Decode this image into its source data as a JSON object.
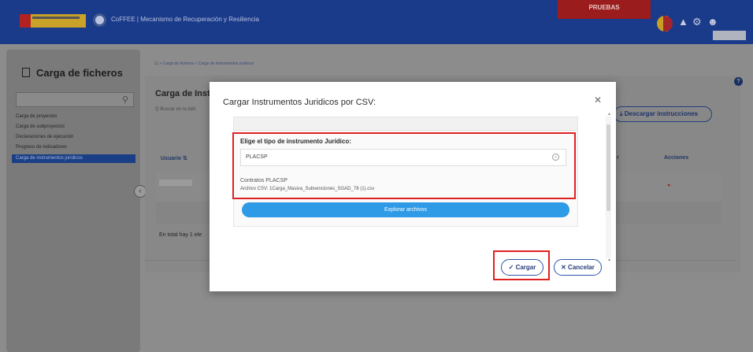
{
  "header": {
    "org_text": "CoFFEE  |  Mecanismo de Recuperación y Resiliencia",
    "env_badge": "PRUEBAS",
    "icons": [
      "bell-icon",
      "gear-icon",
      "user-icon"
    ]
  },
  "sidebar": {
    "title": "Carga de ficheros",
    "items": [
      {
        "label": "Carga de proyectos"
      },
      {
        "label": "Carga de subproyectos"
      },
      {
        "label": "Declaraciones de ejecución"
      },
      {
        "label": "Progreso de indicadores"
      },
      {
        "label": "Carga de instrumentos jurídicos"
      }
    ],
    "collapse_glyph": "‹"
  },
  "main": {
    "breadcrumb": "> Carga de ficheros > Carga de instrumentos jurídicos",
    "title": "Carga de Instr",
    "search_placeholder": "Q  Buscar en la tabl",
    "download_button": "⤓  Descargar instrucciones",
    "columns": {
      "user": "Usuario  ⇅",
      "r": "r",
      "actions": "Acciones"
    },
    "total_text": "En total hay 1 ele"
  },
  "modal": {
    "title": "Cargar Instrumentos Juridicos por CSV:",
    "close": "✕",
    "select_label": "Elige el tipo de instrumento Jurídico:",
    "select_value": "PLACSP",
    "file_type": "Contratos PLACSP",
    "file_name": "Archivo CSV: 1Carga_Masiva_Subvenciones_SGAD_78 (1).csv",
    "explore_button": "Explorar archivos",
    "cargar_button": "✓ Cargar",
    "cancel_button": "✕ Cancelar"
  },
  "colors": {
    "header_bg": "#1a3a8a",
    "primary_blue": "#2f9ae5",
    "highlight_red": "#e02020",
    "env_badge_bg": "#9a1c1c"
  }
}
